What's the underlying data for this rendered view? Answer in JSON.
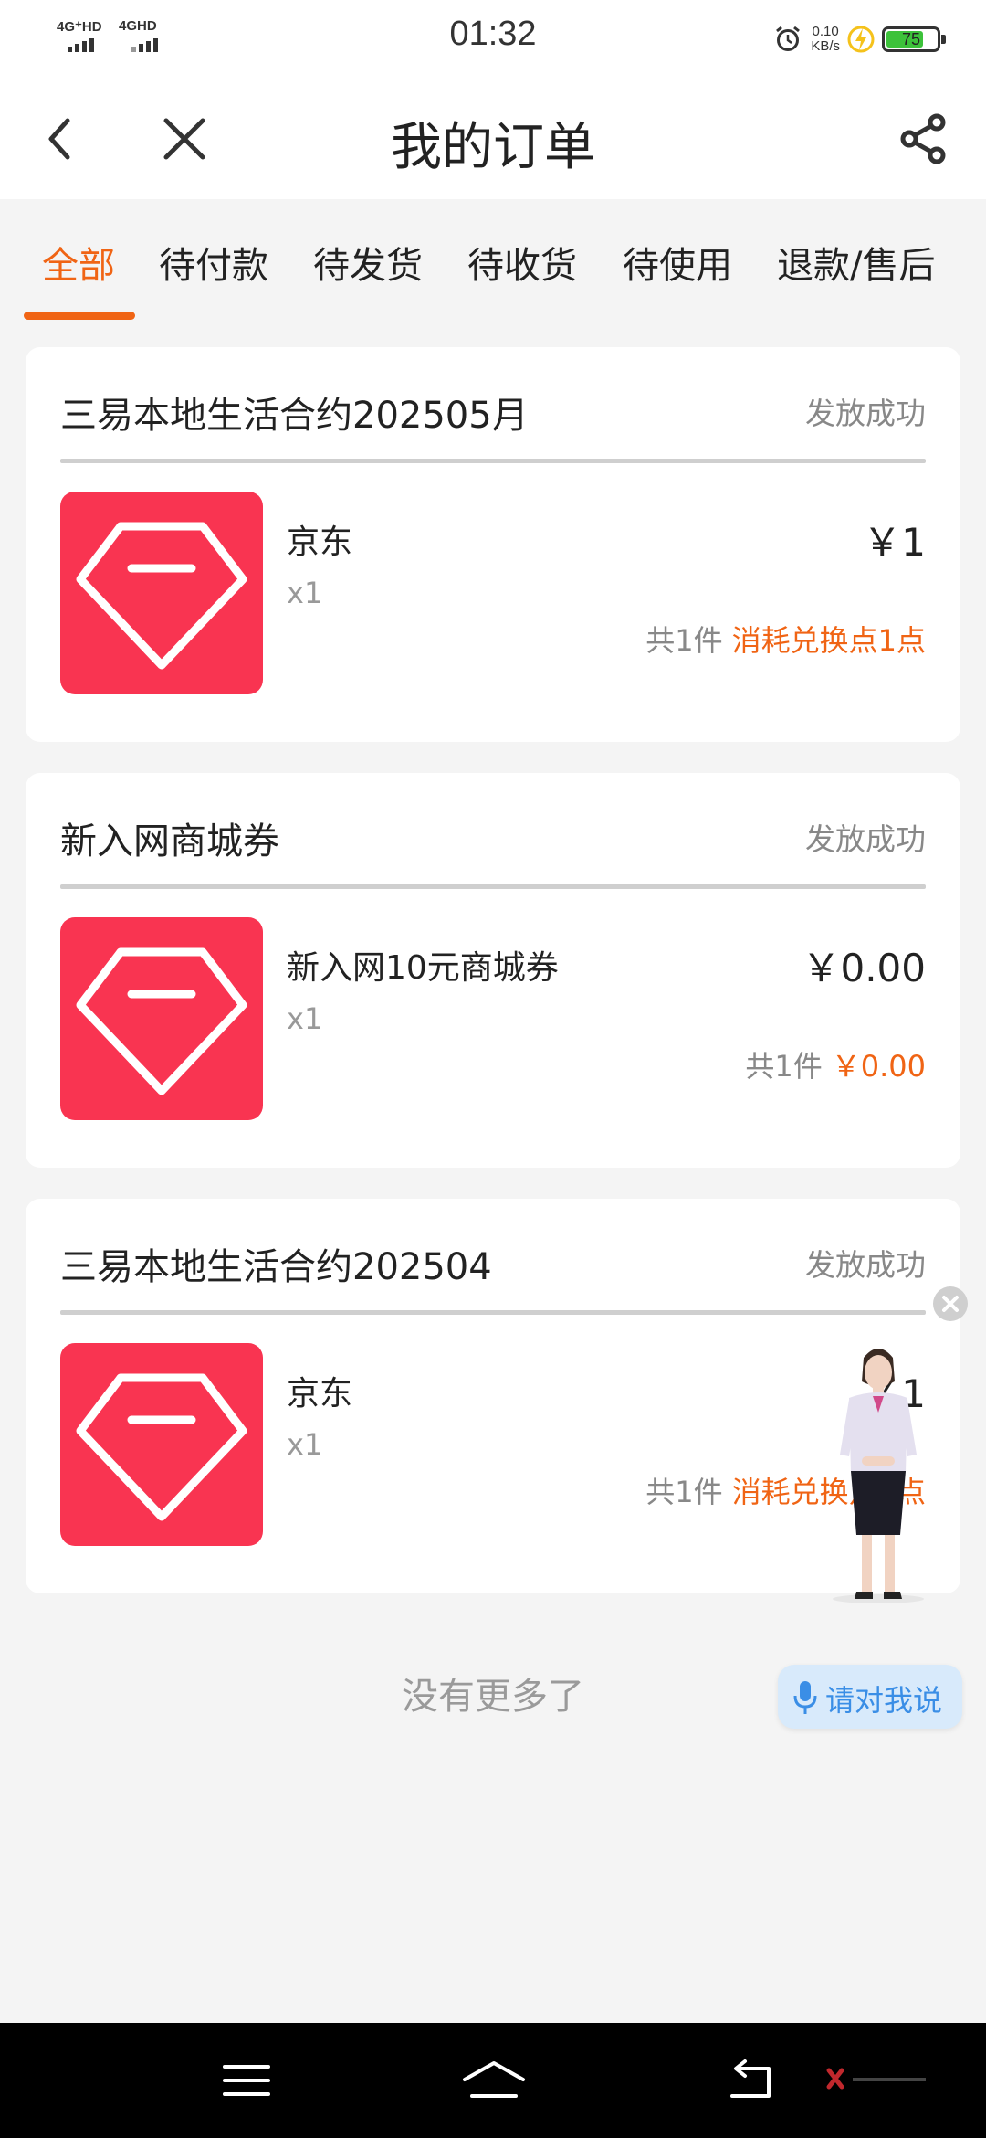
{
  "status_bar": {
    "network1": "4G⁺HD",
    "network2": "4GHD",
    "time": "01:32",
    "speed_value": "0.10",
    "speed_unit": "KB/s",
    "battery": "75",
    "battery_level": 0.75
  },
  "nav": {
    "title": "我的订单",
    "back_icon": "chevron-left-icon",
    "close_icon": "close-icon",
    "share_icon": "share-icon"
  },
  "tabs": [
    {
      "label": "全部",
      "active": true
    },
    {
      "label": "待付款",
      "active": false
    },
    {
      "label": "待发货",
      "active": false
    },
    {
      "label": "待收货",
      "active": false
    },
    {
      "label": "待使用",
      "active": false
    },
    {
      "label": "退款/售后",
      "active": false
    }
  ],
  "orders": [
    {
      "title": "三易本地生活合约202505月",
      "status": "发放成功",
      "item_name": "京东",
      "qty": "x1",
      "price": "￥1",
      "count": "共1件",
      "cost": "消耗兑换点1点"
    },
    {
      "title": "新入网商城券",
      "status": "发放成功",
      "item_name": "新入网10元商城券",
      "qty": "x1",
      "price": "￥0.00",
      "count": "共1件",
      "cost": "￥0.00"
    },
    {
      "title": "三易本地生活合约202504",
      "status": "发放成功",
      "item_name": "京东",
      "qty": "x1",
      "price": "￥1",
      "count": "共1件",
      "cost": "消耗兑换点1点"
    }
  ],
  "footer": {
    "no_more": "没有更多了"
  },
  "assistant": {
    "voice_label": "请对我说"
  },
  "colors": {
    "accent": "#f06414",
    "thumb": "#f93451",
    "voice": "#3a8ee6"
  }
}
